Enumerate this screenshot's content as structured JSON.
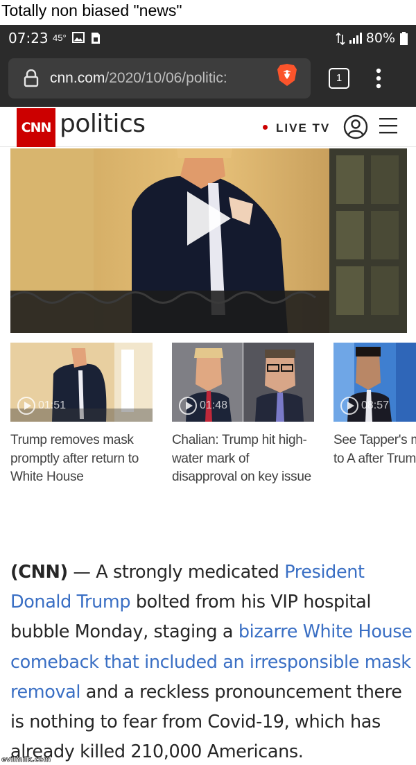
{
  "caption": "Totally non biased \"news\"",
  "status_bar": {
    "time": "07:23",
    "temperature": "45°",
    "battery": "80%"
  },
  "browser": {
    "url_host": "cnn.com",
    "url_path": "/2020/10/06/politic:",
    "tab_count": "1"
  },
  "site_header": {
    "logo": "CNN",
    "section": "politics",
    "live_tv": "LIVE TV"
  },
  "videos": [
    {
      "duration": "01:51",
      "title": "Trump removes mask promptly after return to White House"
    },
    {
      "duration": "01:48",
      "title": "Chalian: Trump hit high-water mark of disapproval on key issue"
    },
    {
      "duration": "08:57",
      "title": "See Tapper's message to A after Trump's tweet"
    }
  ],
  "article": {
    "lead": "(CNN)",
    "dash": " — ",
    "t1": "A strongly medicated ",
    "link1": "President Donald Trump",
    "t2": " bolted from his VIP hospital bubble Monday, staging a ",
    "link2": "bizarre White House comeback that included an irresponsible mask removal",
    "t3": " and a reckless pronouncement there is nothing to fear from Covid-19, which has already killed 210,000 Americans."
  },
  "watermark": "evilmilk.com",
  "colors": {
    "brand_red": "#cc0000",
    "link_blue": "#3a6fc4",
    "chrome_dark": "#2b2b2b"
  }
}
